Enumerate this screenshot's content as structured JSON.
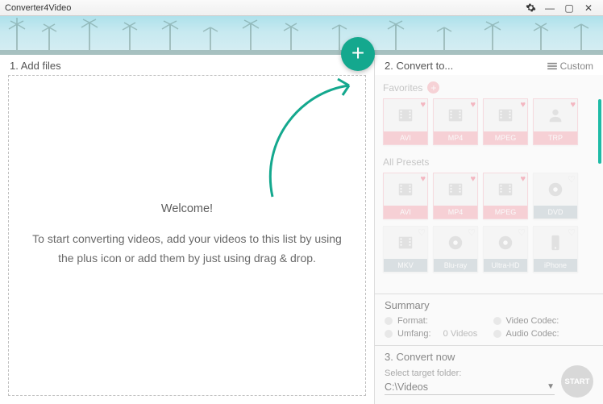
{
  "app_title": "Converter4Video",
  "left": {
    "head": "1. Add files",
    "welcome": "Welcome!",
    "hint": "To start converting videos, add your videos to this list by using the plus icon or add them by just using drag & drop."
  },
  "right": {
    "head": "2. Convert to...",
    "custom": "Custom",
    "favorites_label": "Favorites",
    "all_presets_label": "All Presets",
    "favorites": [
      "AVI",
      "MP4",
      "MPEG",
      "TRP"
    ],
    "presets_row1": [
      "AVI",
      "MP4",
      "MPEG",
      "DVD"
    ],
    "presets_row2": [
      "MKV",
      "Blu-ray",
      "Ultra-HD",
      "iPhone"
    ]
  },
  "summary": {
    "title": "Summary",
    "format": "Format:",
    "video_codec": "Video Codec:",
    "umfang": "Umfang:",
    "umfang_value": "0 Videos",
    "audio_codec": "Audio Codec:"
  },
  "convert": {
    "title": "3. Convert now",
    "sub": "Select target folder:",
    "folder": "C:\\Videos",
    "start": "START"
  }
}
